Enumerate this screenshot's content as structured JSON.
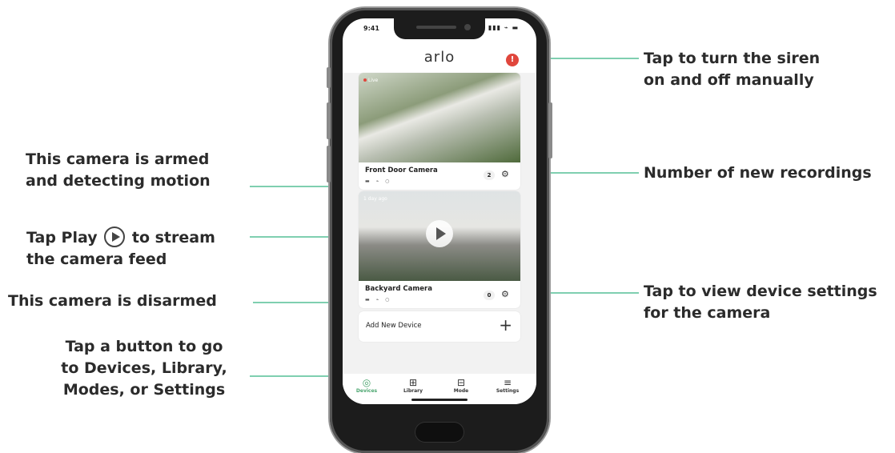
{
  "callouts": {
    "siren": [
      "Tap to turn the siren",
      "on and off manually"
    ],
    "armed": [
      "This camera is armed",
      "and detecting motion"
    ],
    "recordings": "Number of new recordings",
    "play_pre": "Tap Play",
    "play_post": "to stream",
    "play_line2": "the camera feed",
    "disarmed": "This camera is disarmed",
    "settings": [
      "Tap to view device settings",
      "for the camera"
    ],
    "tabs": [
      "Tap a button to go",
      "to Devices, Library,",
      "Modes, or Settings"
    ]
  },
  "phone": {
    "time": "9:41",
    "status_icons": "▮▮▮ ⌁ ▬",
    "app_title": "arlo",
    "siren_icon": "!",
    "cameras": [
      {
        "name": "Front Door Camera",
        "feed_tag": "Live",
        "badge": "2",
        "status_icons": "▬ ⌁ ○"
      },
      {
        "name": "Backyard Camera",
        "feed_tag": "1 day ago",
        "badge": "0",
        "status_icons": "▬ ⌁ ○"
      }
    ],
    "add_device": {
      "label": "Add New Device",
      "icon": "+"
    },
    "tabs": [
      {
        "label": "Devices",
        "icon": "◎",
        "active": true
      },
      {
        "label": "Library",
        "icon": "⊞",
        "active": false
      },
      {
        "label": "Mode",
        "icon": "⊟",
        "active": false
      },
      {
        "label": "Settings",
        "icon": "≡",
        "active": false
      }
    ]
  },
  "colors": {
    "accent": "#7fcfb0",
    "siren": "#e0463c",
    "active_tab": "#4aa56e"
  }
}
